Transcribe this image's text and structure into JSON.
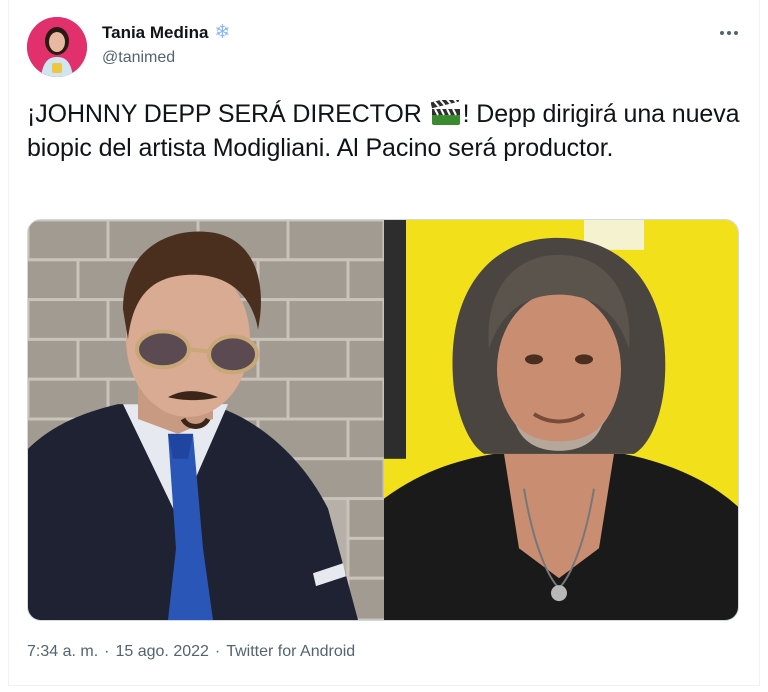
{
  "tweet": {
    "author": {
      "display_name": "Tania Medina",
      "verified_badge_icon": "snowflake-icon",
      "badge_glyph": "❄",
      "handle": "@tanimed",
      "avatar_bg": "#e1306c"
    },
    "text_before_emoji": "¡JOHNNY DEPP SERÁ DIRECTOR ",
    "emoji_icon": "clapper-board-icon",
    "text_after_emoji": "! Depp dirigirá una nueva biopic del artista Modigliani. Al Pacino será productor.",
    "media": {
      "left_photo": "photo-of-man-with-tinted-glasses-and-blue-tie",
      "right_photo": "photo-of-man-with-long-gray-hair-on-yellow-background"
    },
    "footer": {
      "time": "7:34 a. m.",
      "separator1": "·",
      "date": "15 ago. 2022",
      "separator2": "·",
      "source": "Twitter for Android"
    },
    "colors": {
      "text": "#0f1419",
      "secondary": "#536471",
      "border": "#cfd9de",
      "yellow_bg": "#f2e11a"
    }
  }
}
